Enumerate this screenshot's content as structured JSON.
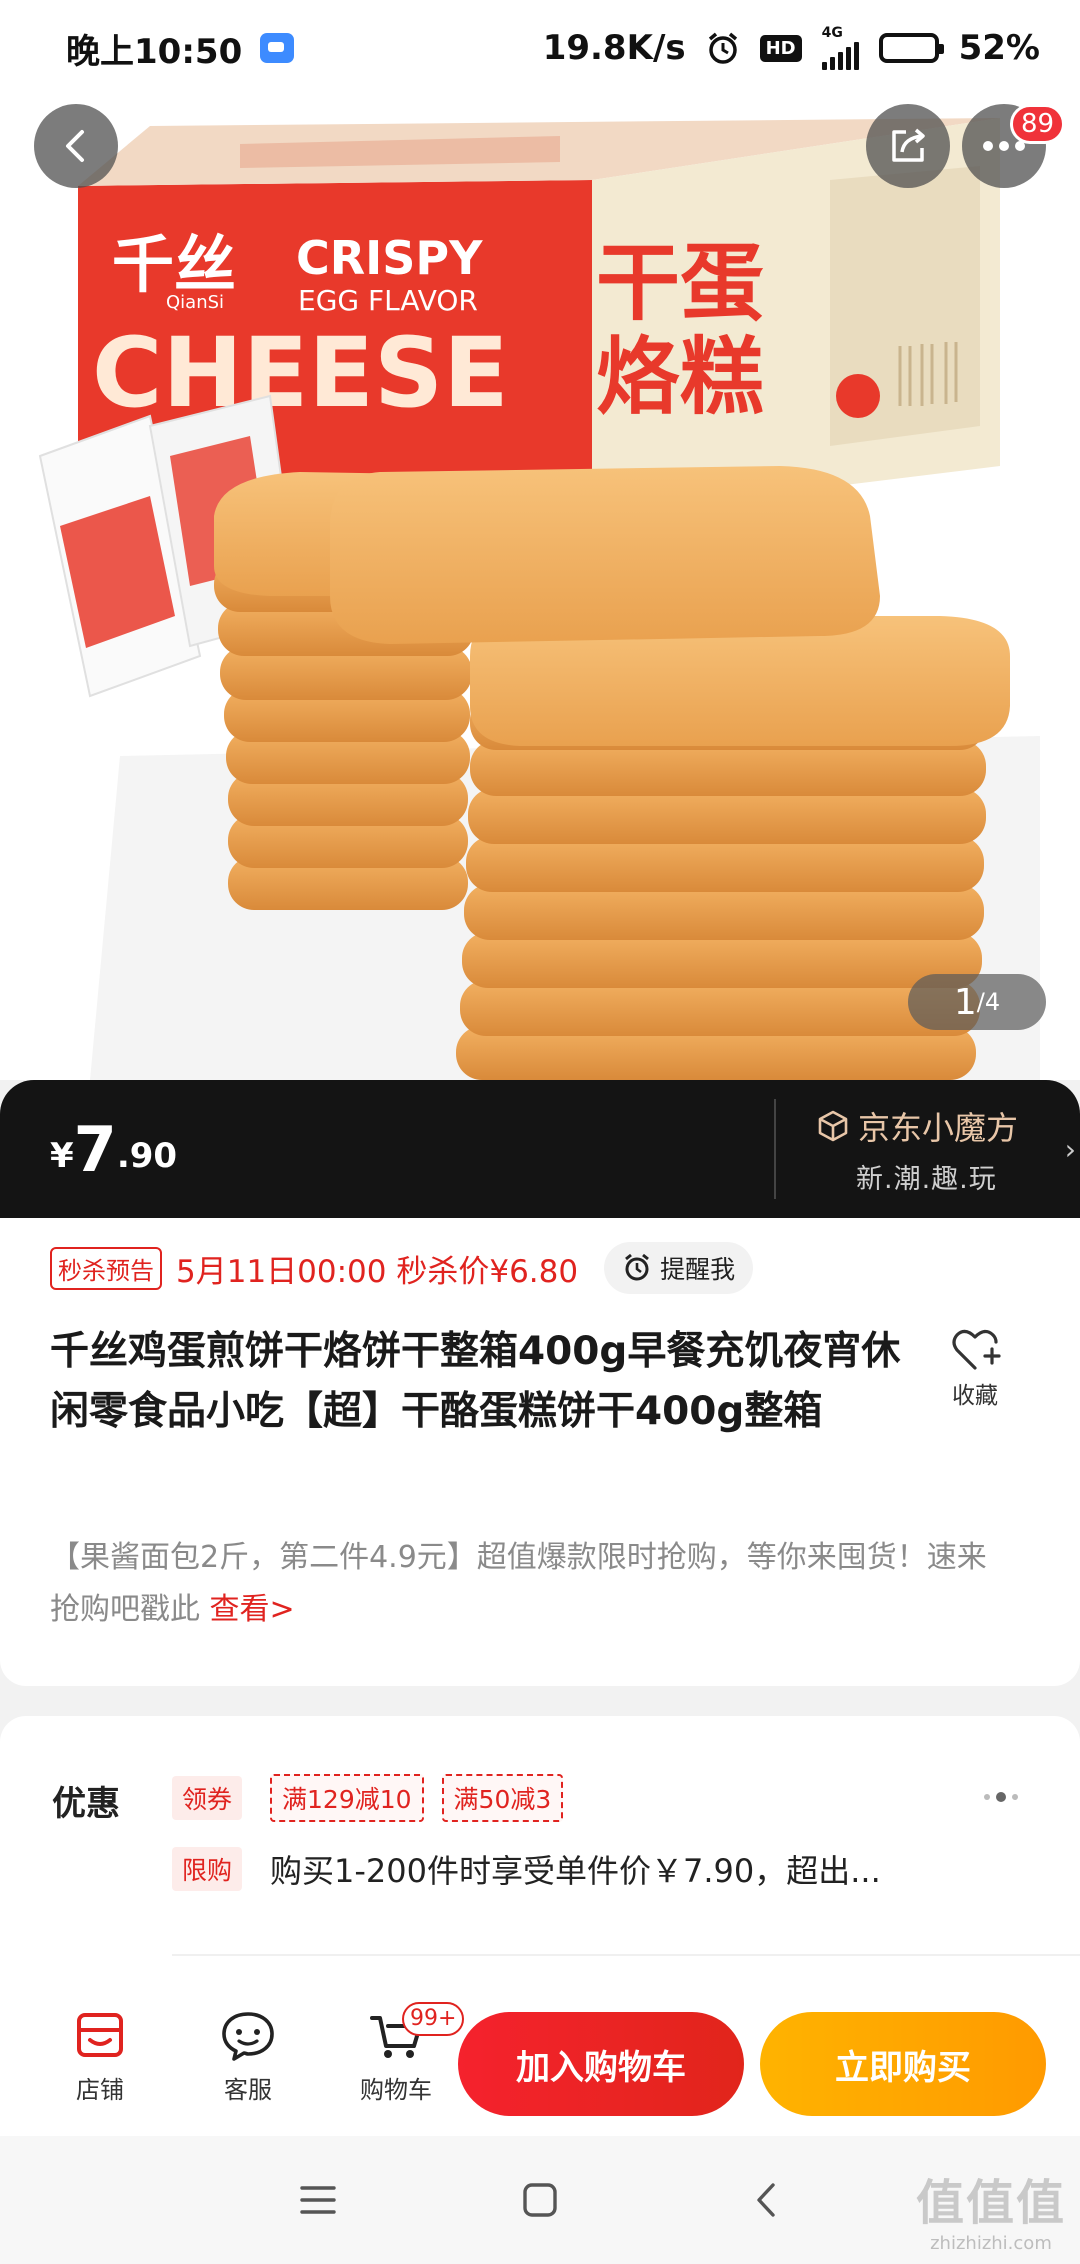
{
  "status_bar": {
    "time": "晚上10:50",
    "net_speed": "19.8K/s",
    "hd": "HD",
    "network_type": "4G",
    "battery": "52%"
  },
  "gallery": {
    "page_current": "1",
    "page_total": "/4",
    "more_badge": "89",
    "image_text": {
      "brand_logo": "千丝",
      "brand_latin": "QianSi",
      "crispy": "CRISPY",
      "egg_flavor": "EGG FLAVOR",
      "cheese": "CHEESE",
      "chinese_name_1": "干蛋",
      "chinese_name_2": "烙糕"
    }
  },
  "price_bar": {
    "currency": "¥",
    "integer": "7",
    "decimal": ".90",
    "jd_title": "京东小魔方",
    "jd_subtitle": "新.潮.趣.玩",
    "arrow": "›"
  },
  "presale": {
    "tag": "秒杀预告",
    "text": "5月11日00:00 秒杀价¥6.80",
    "remind_label": "提醒我"
  },
  "product": {
    "title": "千丝鸡蛋煎饼干烙饼干整箱400g早餐充饥夜宵休闲零食品小吃【超】干酪蛋糕饼干400g整箱",
    "favorite_label": "收藏",
    "promo_text": "【果酱面包2斤，第二件4.9元】超值爆款限时抢购，等你来囤货！速来抢购吧戳此 ",
    "promo_link": "查看>"
  },
  "offers": {
    "label": "优惠",
    "coupon_tag": "领券",
    "coupons": [
      "满129减10",
      "满50减3"
    ],
    "limit_tag": "限购",
    "limit_text": "购买1-200件时享受单件价￥7.90，超出..."
  },
  "action_bar": {
    "store_label": "店铺",
    "service_label": "客服",
    "cart_label": "购物车",
    "cart_badge": "99+",
    "add_cart": "加入购物车",
    "buy_now": "立即购买"
  },
  "watermark": {
    "logo": "值值值",
    "url": "zhizhizhi.com"
  },
  "colors": {
    "accent_red": "#e0231f",
    "buy_orange": "#ffa200",
    "price_bar": "#141414"
  }
}
